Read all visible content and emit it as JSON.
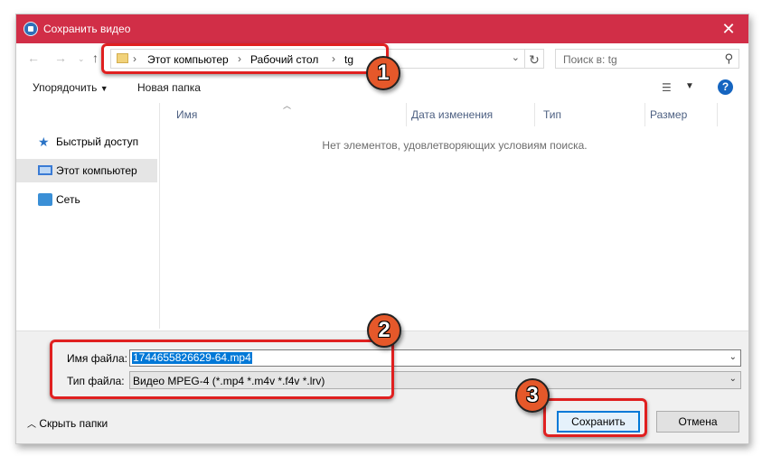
{
  "window": {
    "title": "Сохранить видео",
    "close_icon": "close-icon"
  },
  "nav": {
    "back_icon": "arrow-left-icon",
    "forward_icon": "arrow-right-icon",
    "up_icon": "arrow-up-icon",
    "breadcrumbs": [
      "Этот компьютер",
      "Рабочий стол",
      "tg"
    ],
    "search_placeholder": "Поиск в: tg"
  },
  "toolbar": {
    "organize_label": "Упорядочить",
    "new_folder_label": "Новая папка"
  },
  "sidebar": {
    "items": [
      {
        "label": "Быстрый доступ",
        "icon": "star-icon"
      },
      {
        "label": "Этот компьютер",
        "icon": "computer-icon",
        "selected": true
      },
      {
        "label": "Сеть",
        "icon": "network-icon"
      }
    ]
  },
  "filelist": {
    "columns": [
      "Имя",
      "Дата изменения",
      "Тип",
      "Размер"
    ],
    "empty_message": "Нет элементов, удовлетворяющих условиям поиска."
  },
  "form": {
    "filename_label": "Имя файла:",
    "filename_value": "1744655826629-64.mp4",
    "filetype_label": "Тип файла:",
    "filetype_value": "Видео MPEG-4 (*.mp4 *.m4v *.f4v *.lrv)"
  },
  "footer": {
    "hide_folders_label": "Скрыть папки",
    "save_label": "Сохранить",
    "cancel_label": "Отмена"
  },
  "annotations": {
    "step1": "1",
    "step2": "2",
    "step3": "3"
  },
  "colors": {
    "titlebar": "#d12e47",
    "highlight": "#e02020",
    "badge": "#e5582a"
  }
}
